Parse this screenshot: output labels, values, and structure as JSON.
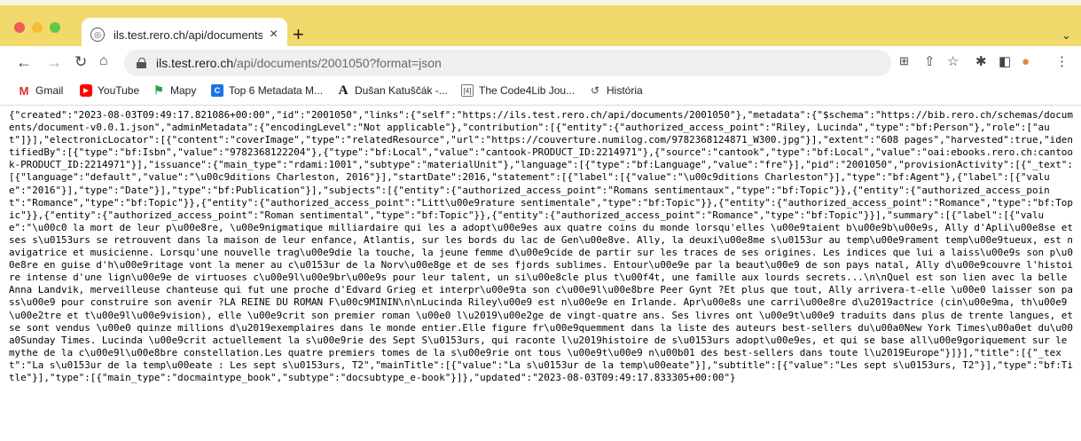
{
  "window": {
    "tab_title": "ils.test.rero.ch/api/documents/",
    "tab_close": "×",
    "new_tab": "+"
  },
  "address_bar": {
    "host": "ils.test.rero.ch",
    "path": "/api/documents/2001050?format=json"
  },
  "bookmarks": [
    {
      "label": "Gmail",
      "icon": "gmail-icon"
    },
    {
      "label": "YouTube",
      "icon": "youtube-icon"
    },
    {
      "label": "Mapy",
      "icon": "mapy-icon"
    },
    {
      "label": "Top 6 Metadata M...",
      "icon": "metadata-icon"
    },
    {
      "label": "Dušan Katuščák -...",
      "icon": "letter-a-icon"
    },
    {
      "label": "The Code4Lib Jou...",
      "icon": "code4lib-icon"
    },
    {
      "label": "História",
      "icon": "history-icon"
    }
  ],
  "json_body": "{\"created\":\"2023-08-03T09:49:17.821086+00:00\",\"id\":\"2001050\",\"links\":{\"self\":\"https://ils.test.rero.ch/api/documents/2001050\"},\"metadata\":{\"$schema\":\"https://bib.rero.ch/schemas/documents/document-v0.0.1.json\",\"adminMetadata\":{\"encodingLevel\":\"Not applicable\"},\"contribution\":[{\"entity\":{\"authorized_access_point\":\"Riley, Lucinda\",\"type\":\"bf:Person\"},\"role\":[\"aut\"]}],\"electronicLocator\":[{\"content\":\"coverImage\",\"type\":\"relatedResource\",\"url\":\"https://couverture.numilog.com/9782368124871_W300.jpg\"}],\"extent\":\"608 pages\",\"harvested\":true,\"identifiedBy\":[{\"type\":\"bf:Isbn\",\"value\":\"9782368122204\"},{\"type\":\"bf:Local\",\"value\":\"cantook-PRODUCT_ID:2214971\"},{\"source\":\"cantook\",\"type\":\"bf:Local\",\"value\":\"oai:ebooks.rero.ch:cantook-PRODUCT_ID:2214971\"}],\"issuance\":{\"main_type\":\"rdami:1001\",\"subtype\":\"materialUnit\"},\"language\":[{\"type\":\"bf:Language\",\"value\":\"fre\"}],\"pid\":\"2001050\",\"provisionActivity\":[{\"_text\":[{\"language\":\"default\",\"value\":\"\\u00c9ditions Charleston, 2016\"}],\"startDate\":2016,\"statement\":[{\"label\":[{\"value\":\"\\u00c9ditions Charleston\"}],\"type\":\"bf:Agent\"},{\"label\":[{\"value\":\"2016\"}],\"type\":\"Date\"}],\"type\":\"bf:Publication\"}],\"subjects\":[{\"entity\":{\"authorized_access_point\":\"Romans sentimentaux\",\"type\":\"bf:Topic\"}},{\"entity\":{\"authorized_access_point\":\"Romance\",\"type\":\"bf:Topic\"}},{\"entity\":{\"authorized_access_point\":\"Litt\\u00e9rature sentimentale\",\"type\":\"bf:Topic\"}},{\"entity\":{\"authorized_access_point\":\"Romance\",\"type\":\"bf:Topic\"}},{\"entity\":{\"authorized_access_point\":\"Roman sentimental\",\"type\":\"bf:Topic\"}},{\"entity\":{\"authorized_access_point\":\"Romance\",\"type\":\"bf:Topic\"}}],\"summary\":[{\"label\":[{\"value\":\"\\u00c0 la mort de leur p\\u00e8re, \\u00e9nigmatique milliardaire qui les a adopt\\u00e9es aux quatre coins du monde lorsqu'elles \\u00e9taient b\\u00e9b\\u00e9s, Ally d'Apli\\u00e8se et ses s\\u0153urs se retrouvent dans la maison de leur enfance, Atlantis, sur les bords du lac de Gen\\u00e8ve. Ally, la deuxi\\u00e8me s\\u0153ur au temp\\u00e9rament temp\\u00e9tueux, est navigatrice et musicienne. Lorsqu'une nouvelle trag\\u00e9die la touche, la jeune femme d\\u00e9cide de partir sur les traces de ses origines. Les indices que lui a laiss\\u00e9s son p\\u00e8re en guise d'h\\u00e9ritage vont la mener au c\\u0153ur de la Norv\\u00e8ge et de ses fjords sublimes. Entour\\u00e9e par la beaut\\u00e9 de son pays natal, Ally d\\u00e9couvre l'histoire intense d'une lign\\u00e9e de virtuoses c\\u00e9l\\u00e9br\\u00e9s pour leur talent, un si\\u00e8cle plus t\\u00f4t, une famille aux lourds secrets...\\n\\nQuel est son lien avec la belle Anna Landvik, merveilleuse chanteuse qui fut une proche d'Edvard Grieg et interpr\\u00e9ta son c\\u00e9l\\u00e8bre Peer Gynt ?Et plus que tout, Ally arrivera-t-elle \\u00e0 laisser son pass\\u00e9 pour construire son avenir ?LA REINE DU ROMAN F\\u00c9MININ\\n\\nLucinda Riley\\u00e9 est n\\u00e9e en Irlande. Apr\\u00e8s une carri\\u00e8re d\\u2019actrice (cin\\u00e9ma, th\\u00e9\\u00e2tre et t\\u00e9l\\u00e9vision), elle \\u00e9crit son premier roman \\u00e0 l\\u2019\\u00e2ge de vingt-quatre ans. Ses livres ont \\u00e9t\\u00e9 traduits dans plus de trente langues, et se sont vendus \\u00e0 quinze millions d\\u2019exemplaires dans le monde entier.Elle figure fr\\u00e9quemment dans la liste des auteurs best-sellers du\\u00a0New York Times\\u00a0et du\\u00a0Sunday Times. Lucinda \\u00e9crit actuellement la s\\u00e9rie des Sept S\\u0153urs, qui raconte l\\u2019histoire de s\\u0153urs adopt\\u00e9es, et qui se base all\\u00e9goriquement sur le mythe de la c\\u00e9l\\u00e8bre constellation.Les quatre premiers tomes de la s\\u00e9rie ont tous \\u00e9t\\u00e9 n\\u00b01 des best-sellers dans toute l\\u2019Europe\"}]}],\"title\":[{\"_text\":\"La s\\u0153ur de la temp\\u00eate : Les sept s\\u0153urs, T2\",\"mainTitle\":[{\"value\":\"La s\\u0153ur de la temp\\u00eate\"}],\"subtitle\":[{\"value\":\"Les sept s\\u0153urs, T2\"}],\"type\":\"bf:Title\"}],\"type\":[{\"main_type\":\"docmaintype_book\",\"subtype\":\"docsubtype_e-book\"}]},\"updated\":\"2023-08-03T09:49:17.833305+00:00\"}"
}
